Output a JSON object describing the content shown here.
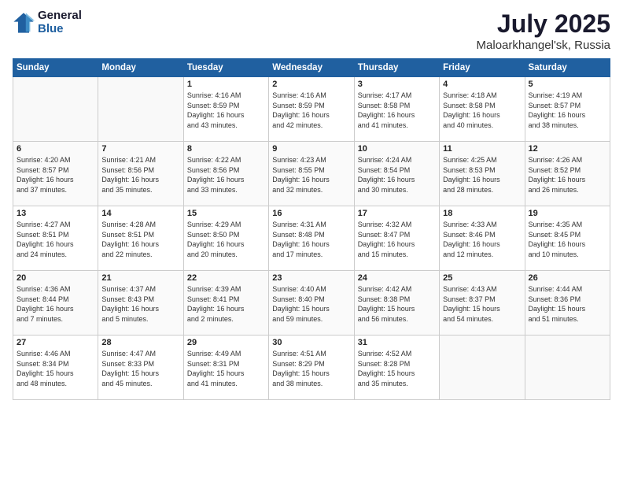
{
  "header": {
    "logo": {
      "general": "General",
      "blue": "Blue"
    },
    "title": "July 2025",
    "location": "Maloarkhangel'sk, Russia"
  },
  "days_of_week": [
    "Sunday",
    "Monday",
    "Tuesday",
    "Wednesday",
    "Thursday",
    "Friday",
    "Saturday"
  ],
  "weeks": [
    [
      {
        "day": "",
        "detail": ""
      },
      {
        "day": "",
        "detail": ""
      },
      {
        "day": "1",
        "detail": "Sunrise: 4:16 AM\nSunset: 8:59 PM\nDaylight: 16 hours\nand 43 minutes."
      },
      {
        "day": "2",
        "detail": "Sunrise: 4:16 AM\nSunset: 8:59 PM\nDaylight: 16 hours\nand 42 minutes."
      },
      {
        "day": "3",
        "detail": "Sunrise: 4:17 AM\nSunset: 8:58 PM\nDaylight: 16 hours\nand 41 minutes."
      },
      {
        "day": "4",
        "detail": "Sunrise: 4:18 AM\nSunset: 8:58 PM\nDaylight: 16 hours\nand 40 minutes."
      },
      {
        "day": "5",
        "detail": "Sunrise: 4:19 AM\nSunset: 8:57 PM\nDaylight: 16 hours\nand 38 minutes."
      }
    ],
    [
      {
        "day": "6",
        "detail": "Sunrise: 4:20 AM\nSunset: 8:57 PM\nDaylight: 16 hours\nand 37 minutes."
      },
      {
        "day": "7",
        "detail": "Sunrise: 4:21 AM\nSunset: 8:56 PM\nDaylight: 16 hours\nand 35 minutes."
      },
      {
        "day": "8",
        "detail": "Sunrise: 4:22 AM\nSunset: 8:56 PM\nDaylight: 16 hours\nand 33 minutes."
      },
      {
        "day": "9",
        "detail": "Sunrise: 4:23 AM\nSunset: 8:55 PM\nDaylight: 16 hours\nand 32 minutes."
      },
      {
        "day": "10",
        "detail": "Sunrise: 4:24 AM\nSunset: 8:54 PM\nDaylight: 16 hours\nand 30 minutes."
      },
      {
        "day": "11",
        "detail": "Sunrise: 4:25 AM\nSunset: 8:53 PM\nDaylight: 16 hours\nand 28 minutes."
      },
      {
        "day": "12",
        "detail": "Sunrise: 4:26 AM\nSunset: 8:52 PM\nDaylight: 16 hours\nand 26 minutes."
      }
    ],
    [
      {
        "day": "13",
        "detail": "Sunrise: 4:27 AM\nSunset: 8:51 PM\nDaylight: 16 hours\nand 24 minutes."
      },
      {
        "day": "14",
        "detail": "Sunrise: 4:28 AM\nSunset: 8:51 PM\nDaylight: 16 hours\nand 22 minutes."
      },
      {
        "day": "15",
        "detail": "Sunrise: 4:29 AM\nSunset: 8:50 PM\nDaylight: 16 hours\nand 20 minutes."
      },
      {
        "day": "16",
        "detail": "Sunrise: 4:31 AM\nSunset: 8:48 PM\nDaylight: 16 hours\nand 17 minutes."
      },
      {
        "day": "17",
        "detail": "Sunrise: 4:32 AM\nSunset: 8:47 PM\nDaylight: 16 hours\nand 15 minutes."
      },
      {
        "day": "18",
        "detail": "Sunrise: 4:33 AM\nSunset: 8:46 PM\nDaylight: 16 hours\nand 12 minutes."
      },
      {
        "day": "19",
        "detail": "Sunrise: 4:35 AM\nSunset: 8:45 PM\nDaylight: 16 hours\nand 10 minutes."
      }
    ],
    [
      {
        "day": "20",
        "detail": "Sunrise: 4:36 AM\nSunset: 8:44 PM\nDaylight: 16 hours\nand 7 minutes."
      },
      {
        "day": "21",
        "detail": "Sunrise: 4:37 AM\nSunset: 8:43 PM\nDaylight: 16 hours\nand 5 minutes."
      },
      {
        "day": "22",
        "detail": "Sunrise: 4:39 AM\nSunset: 8:41 PM\nDaylight: 16 hours\nand 2 minutes."
      },
      {
        "day": "23",
        "detail": "Sunrise: 4:40 AM\nSunset: 8:40 PM\nDaylight: 15 hours\nand 59 minutes."
      },
      {
        "day": "24",
        "detail": "Sunrise: 4:42 AM\nSunset: 8:38 PM\nDaylight: 15 hours\nand 56 minutes."
      },
      {
        "day": "25",
        "detail": "Sunrise: 4:43 AM\nSunset: 8:37 PM\nDaylight: 15 hours\nand 54 minutes."
      },
      {
        "day": "26",
        "detail": "Sunrise: 4:44 AM\nSunset: 8:36 PM\nDaylight: 15 hours\nand 51 minutes."
      }
    ],
    [
      {
        "day": "27",
        "detail": "Sunrise: 4:46 AM\nSunset: 8:34 PM\nDaylight: 15 hours\nand 48 minutes."
      },
      {
        "day": "28",
        "detail": "Sunrise: 4:47 AM\nSunset: 8:33 PM\nDaylight: 15 hours\nand 45 minutes."
      },
      {
        "day": "29",
        "detail": "Sunrise: 4:49 AM\nSunset: 8:31 PM\nDaylight: 15 hours\nand 41 minutes."
      },
      {
        "day": "30",
        "detail": "Sunrise: 4:51 AM\nSunset: 8:29 PM\nDaylight: 15 hours\nand 38 minutes."
      },
      {
        "day": "31",
        "detail": "Sunrise: 4:52 AM\nSunset: 8:28 PM\nDaylight: 15 hours\nand 35 minutes."
      },
      {
        "day": "",
        "detail": ""
      },
      {
        "day": "",
        "detail": ""
      }
    ]
  ]
}
